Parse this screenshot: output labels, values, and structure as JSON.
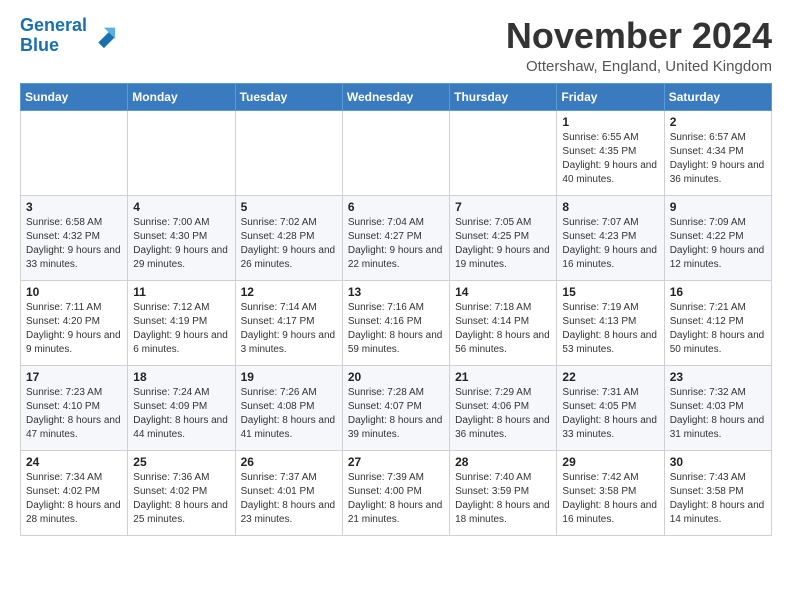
{
  "logo": {
    "text_general": "General",
    "text_blue": "Blue"
  },
  "title": "November 2024",
  "location": "Ottershaw, England, United Kingdom",
  "days_header": [
    "Sunday",
    "Monday",
    "Tuesday",
    "Wednesday",
    "Thursday",
    "Friday",
    "Saturday"
  ],
  "weeks": [
    [
      {
        "day": "",
        "info": ""
      },
      {
        "day": "",
        "info": ""
      },
      {
        "day": "",
        "info": ""
      },
      {
        "day": "",
        "info": ""
      },
      {
        "day": "",
        "info": ""
      },
      {
        "day": "1",
        "info": "Sunrise: 6:55 AM\nSunset: 4:35 PM\nDaylight: 9 hours and 40 minutes."
      },
      {
        "day": "2",
        "info": "Sunrise: 6:57 AM\nSunset: 4:34 PM\nDaylight: 9 hours and 36 minutes."
      }
    ],
    [
      {
        "day": "3",
        "info": "Sunrise: 6:58 AM\nSunset: 4:32 PM\nDaylight: 9 hours and 33 minutes."
      },
      {
        "day": "4",
        "info": "Sunrise: 7:00 AM\nSunset: 4:30 PM\nDaylight: 9 hours and 29 minutes."
      },
      {
        "day": "5",
        "info": "Sunrise: 7:02 AM\nSunset: 4:28 PM\nDaylight: 9 hours and 26 minutes."
      },
      {
        "day": "6",
        "info": "Sunrise: 7:04 AM\nSunset: 4:27 PM\nDaylight: 9 hours and 22 minutes."
      },
      {
        "day": "7",
        "info": "Sunrise: 7:05 AM\nSunset: 4:25 PM\nDaylight: 9 hours and 19 minutes."
      },
      {
        "day": "8",
        "info": "Sunrise: 7:07 AM\nSunset: 4:23 PM\nDaylight: 9 hours and 16 minutes."
      },
      {
        "day": "9",
        "info": "Sunrise: 7:09 AM\nSunset: 4:22 PM\nDaylight: 9 hours and 12 minutes."
      }
    ],
    [
      {
        "day": "10",
        "info": "Sunrise: 7:11 AM\nSunset: 4:20 PM\nDaylight: 9 hours and 9 minutes."
      },
      {
        "day": "11",
        "info": "Sunrise: 7:12 AM\nSunset: 4:19 PM\nDaylight: 9 hours and 6 minutes."
      },
      {
        "day": "12",
        "info": "Sunrise: 7:14 AM\nSunset: 4:17 PM\nDaylight: 9 hours and 3 minutes."
      },
      {
        "day": "13",
        "info": "Sunrise: 7:16 AM\nSunset: 4:16 PM\nDaylight: 8 hours and 59 minutes."
      },
      {
        "day": "14",
        "info": "Sunrise: 7:18 AM\nSunset: 4:14 PM\nDaylight: 8 hours and 56 minutes."
      },
      {
        "day": "15",
        "info": "Sunrise: 7:19 AM\nSunset: 4:13 PM\nDaylight: 8 hours and 53 minutes."
      },
      {
        "day": "16",
        "info": "Sunrise: 7:21 AM\nSunset: 4:12 PM\nDaylight: 8 hours and 50 minutes."
      }
    ],
    [
      {
        "day": "17",
        "info": "Sunrise: 7:23 AM\nSunset: 4:10 PM\nDaylight: 8 hours and 47 minutes."
      },
      {
        "day": "18",
        "info": "Sunrise: 7:24 AM\nSunset: 4:09 PM\nDaylight: 8 hours and 44 minutes."
      },
      {
        "day": "19",
        "info": "Sunrise: 7:26 AM\nSunset: 4:08 PM\nDaylight: 8 hours and 41 minutes."
      },
      {
        "day": "20",
        "info": "Sunrise: 7:28 AM\nSunset: 4:07 PM\nDaylight: 8 hours and 39 minutes."
      },
      {
        "day": "21",
        "info": "Sunrise: 7:29 AM\nSunset: 4:06 PM\nDaylight: 8 hours and 36 minutes."
      },
      {
        "day": "22",
        "info": "Sunrise: 7:31 AM\nSunset: 4:05 PM\nDaylight: 8 hours and 33 minutes."
      },
      {
        "day": "23",
        "info": "Sunrise: 7:32 AM\nSunset: 4:03 PM\nDaylight: 8 hours and 31 minutes."
      }
    ],
    [
      {
        "day": "24",
        "info": "Sunrise: 7:34 AM\nSunset: 4:02 PM\nDaylight: 8 hours and 28 minutes."
      },
      {
        "day": "25",
        "info": "Sunrise: 7:36 AM\nSunset: 4:02 PM\nDaylight: 8 hours and 25 minutes."
      },
      {
        "day": "26",
        "info": "Sunrise: 7:37 AM\nSunset: 4:01 PM\nDaylight: 8 hours and 23 minutes."
      },
      {
        "day": "27",
        "info": "Sunrise: 7:39 AM\nSunset: 4:00 PM\nDaylight: 8 hours and 21 minutes."
      },
      {
        "day": "28",
        "info": "Sunrise: 7:40 AM\nSunset: 3:59 PM\nDaylight: 8 hours and 18 minutes."
      },
      {
        "day": "29",
        "info": "Sunrise: 7:42 AM\nSunset: 3:58 PM\nDaylight: 8 hours and 16 minutes."
      },
      {
        "day": "30",
        "info": "Sunrise: 7:43 AM\nSunset: 3:58 PM\nDaylight: 8 hours and 14 minutes."
      }
    ]
  ]
}
